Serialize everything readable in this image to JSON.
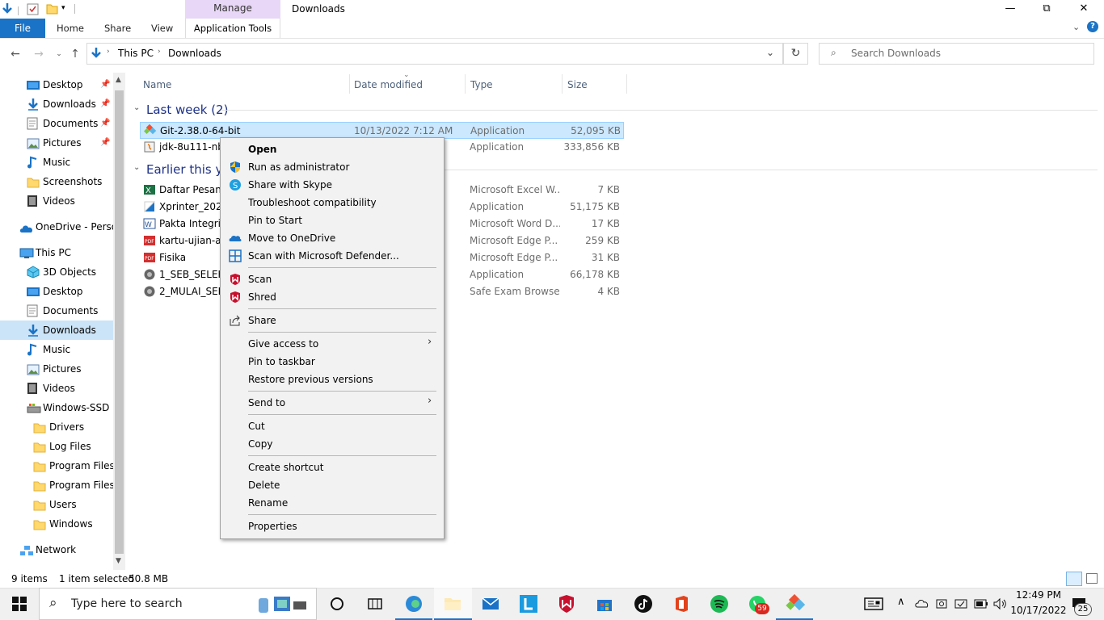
{
  "window": {
    "title": "Downloads",
    "manage_label": "Manage",
    "minimize": "—",
    "maximize": "⧉",
    "close": "✕"
  },
  "ribbon": {
    "file": "File",
    "home": "Home",
    "share": "Share",
    "view": "View",
    "app_tools": "Application Tools"
  },
  "address": {
    "crumbs": [
      "This PC",
      "Downloads"
    ],
    "search_placeholder": "Search Downloads"
  },
  "nav_pane": {
    "items": [
      {
        "label": "Desktop",
        "icon": "desktop-icon",
        "pinned": true
      },
      {
        "label": "Downloads",
        "icon": "download-icon",
        "pinned": true
      },
      {
        "label": "Documents",
        "icon": "documents-icon",
        "pinned": true
      },
      {
        "label": "Pictures",
        "icon": "pictures-icon",
        "pinned": true
      },
      {
        "label": "Music",
        "icon": "music-icon",
        "pinned": false
      },
      {
        "label": "Screenshots",
        "icon": "folder-icon",
        "pinned": false
      },
      {
        "label": "Videos",
        "icon": "videos-icon",
        "pinned": false
      },
      {
        "label": "OneDrive - Persor",
        "icon": "onedrive-icon",
        "pinned": false
      },
      {
        "label": "This PC",
        "icon": "computer-icon",
        "pinned": false
      },
      {
        "label": "3D Objects",
        "icon": "3d-objects-icon",
        "pinned": false
      },
      {
        "label": "Desktop",
        "icon": "desktop-icon",
        "pinned": false
      },
      {
        "label": "Documents",
        "icon": "documents-icon",
        "pinned": false
      },
      {
        "label": "Downloads",
        "icon": "download-icon",
        "pinned": false,
        "selected": true
      },
      {
        "label": "Music",
        "icon": "music-icon",
        "pinned": false
      },
      {
        "label": "Pictures",
        "icon": "pictures-icon",
        "pinned": false
      },
      {
        "label": "Videos",
        "icon": "videos-icon",
        "pinned": false
      },
      {
        "label": "Windows-SSD (C",
        "icon": "drive-icon",
        "pinned": false
      },
      {
        "label": "Drivers",
        "icon": "folder-icon",
        "pinned": false
      },
      {
        "label": "Log Files",
        "icon": "folder-icon",
        "pinned": false
      },
      {
        "label": "Program Files",
        "icon": "folder-icon",
        "pinned": false
      },
      {
        "label": "Program Files (",
        "icon": "folder-icon",
        "pinned": false
      },
      {
        "label": "Users",
        "icon": "folder-icon",
        "pinned": false
      },
      {
        "label": "Windows",
        "icon": "folder-icon",
        "pinned": false
      },
      {
        "label": "Network",
        "icon": "network-icon",
        "pinned": false
      }
    ]
  },
  "columns": {
    "name": "Name",
    "date": "Date modified",
    "type": "Type",
    "size": "Size"
  },
  "groups": {
    "last_week": "Last week (2)",
    "earlier": "Earlier this yea"
  },
  "files": [
    {
      "name": "Git-2.38.0-64-bit",
      "date": "10/13/2022 7:12 AM",
      "type": "Application",
      "size": "52,095 KB",
      "selected": true
    },
    {
      "name": "jdk-8u111-nb-",
      "date": "",
      "type": "Application",
      "size": "333,856 KB"
    },
    {
      "name": "Daftar Pesanan",
      "date": "",
      "type": "Microsoft Excel W...",
      "size": "7 KB"
    },
    {
      "name": "Xprinter_2022.",
      "date": "",
      "type": "Application",
      "size": "51,175 KB"
    },
    {
      "name": "Pakta Integrita",
      "date": "",
      "type": "Microsoft Word D...",
      "size": "17 KB"
    },
    {
      "name": "kartu-ujian-ak",
      "date": "",
      "type": "Microsoft Edge P...",
      "size": "259 KB"
    },
    {
      "name": "Fisika",
      "date": "",
      "type": "Microsoft Edge P...",
      "size": "31 KB"
    },
    {
      "name": "1_SEB_SELEKSI",
      "date": "",
      "type": "Application",
      "size": "66,178 KB"
    },
    {
      "name": "2_MULAI_SELE",
      "date": "",
      "type": "Safe Exam Browse...",
      "size": "4 KB"
    }
  ],
  "context_menu": {
    "open": "Open",
    "run_admin": "Run as administrator",
    "share_skype": "Share with Skype",
    "troubleshoot": "Troubleshoot compatibility",
    "pin_start": "Pin to Start",
    "move_onedrive": "Move to OneDrive",
    "scan_defender": "Scan with Microsoft Defender...",
    "scan": "Scan",
    "shred": "Shred",
    "share": "Share",
    "give_access": "Give access to",
    "pin_taskbar": "Pin to taskbar",
    "restore": "Restore previous versions",
    "send_to": "Send to",
    "cut": "Cut",
    "copy": "Copy",
    "create_shortcut": "Create shortcut",
    "delete": "Delete",
    "rename": "Rename",
    "properties": "Properties"
  },
  "status": {
    "items": "9 items",
    "selected": "1 item selected",
    "size": "50.8 MB"
  },
  "taskbar": {
    "search_placeholder": "Type here to search",
    "time": "12:49 PM",
    "date": "10/17/2022",
    "whatsapp_badge": "59",
    "notif_count": "25"
  }
}
